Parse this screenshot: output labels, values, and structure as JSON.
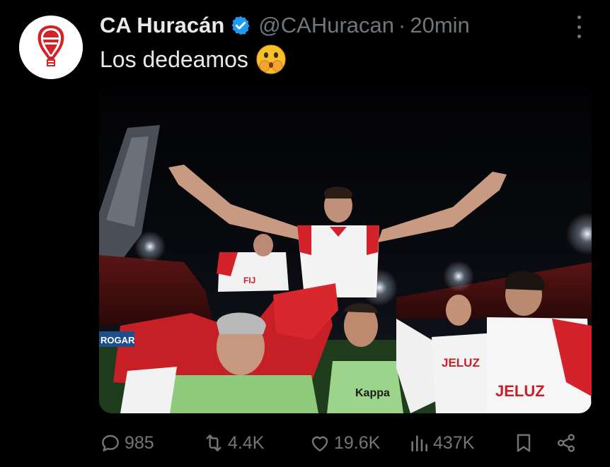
{
  "account": {
    "name": "CA Huracán",
    "handle": "@CAHuracan",
    "separator": "·",
    "time": "20min"
  },
  "tweet": {
    "text": "Los dedeamos"
  },
  "media": {
    "sponsors": [
      "Kappa",
      "JELUZ",
      "JELUZ",
      "ROGAR",
      "FIJ"
    ]
  },
  "actions": {
    "replies": "985",
    "reposts": "4.4K",
    "likes": "19.6K",
    "views": "437K"
  },
  "colors": {
    "background": "#000000",
    "text": "#e7e9ea",
    "muted": "#71767b",
    "verified": "#1d9bf0",
    "club_red": "#d3222a"
  },
  "icons": [
    "verified-badge-icon",
    "more-options-icon",
    "shushing-face-emoji",
    "reply-icon",
    "repost-icon",
    "like-icon",
    "views-icon",
    "bookmark-icon",
    "share-icon",
    "club-crest-icon"
  ]
}
